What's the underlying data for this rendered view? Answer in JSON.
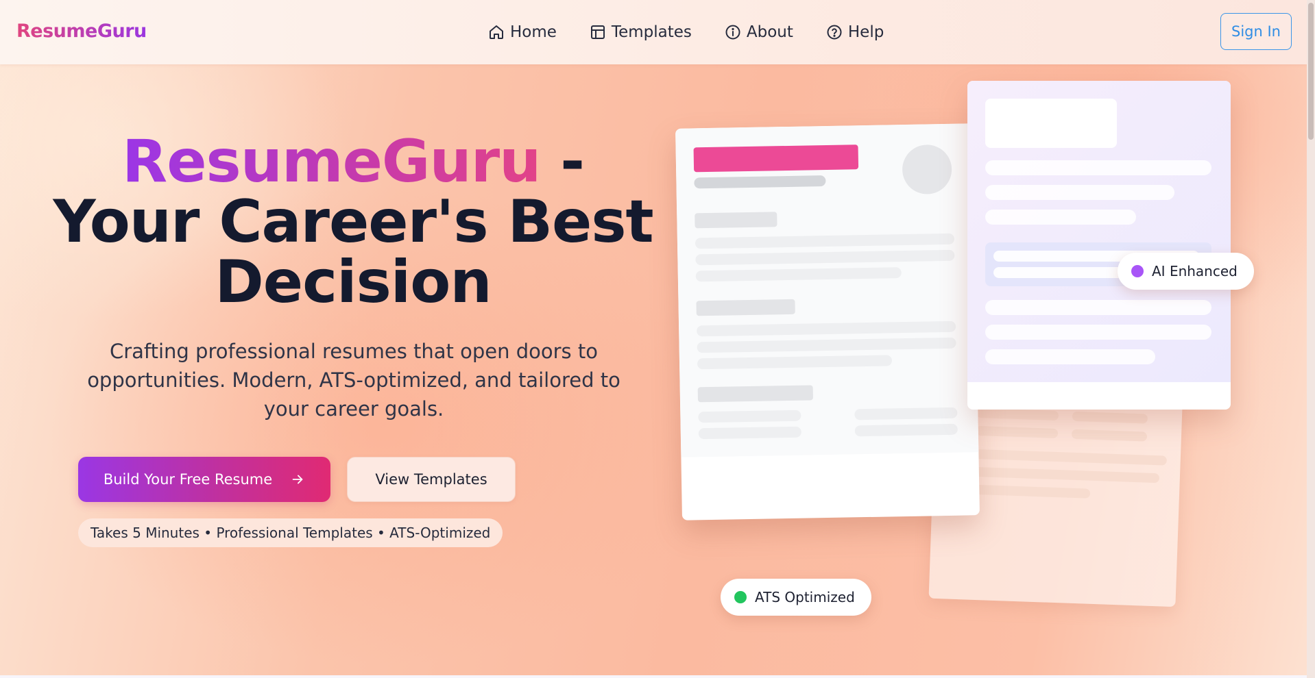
{
  "brand": {
    "logo": "ResumeGuru"
  },
  "nav": {
    "items": [
      {
        "label": "Home",
        "icon": "home-icon"
      },
      {
        "label": "Templates",
        "icon": "layout-icon"
      },
      {
        "label": "About",
        "icon": "info-icon"
      },
      {
        "label": "Help",
        "icon": "help-icon"
      }
    ],
    "sign_in": "Sign In"
  },
  "hero": {
    "title_brand": "ResumeGuru",
    "title_dash": " -",
    "title_line2": "Your Career's Best",
    "title_line3": "Decision",
    "subtitle": "Crafting professional resumes that open doors to opportunities. Modern, ATS-optimized, and tailored to your career goals.",
    "cta_primary": "Build Your Free Resume",
    "cta_primary_icon": "arrow-right-icon",
    "cta_secondary": "View Templates",
    "tagline": "Takes 5 Minutes • Professional Templates • ATS-Optimized"
  },
  "badges": {
    "ai": {
      "label": "AI Enhanced",
      "color": "#a855f7"
    },
    "ats": {
      "label": "ATS Optimized",
      "color": "#22c55e"
    }
  },
  "colors": {
    "accent_pink": "#ec4899",
    "accent_purple": "#9333ea",
    "signin_blue": "#2f8de4"
  }
}
